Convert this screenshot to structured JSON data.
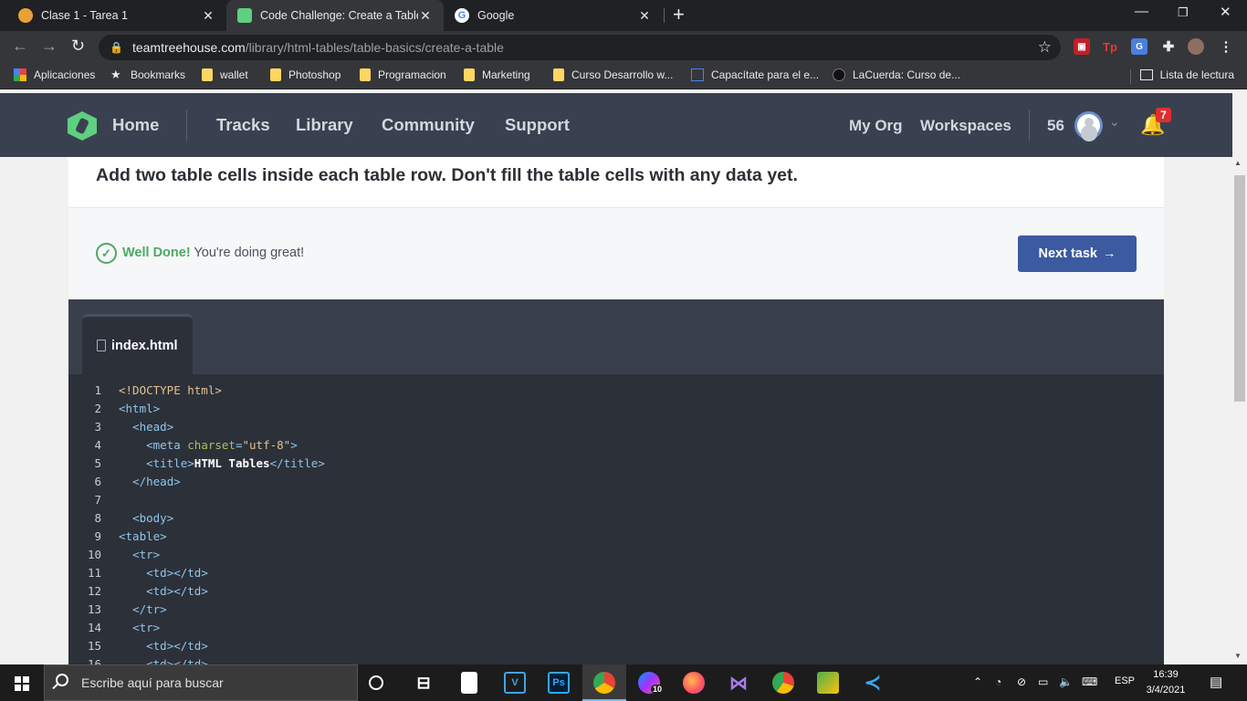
{
  "browser": {
    "tabs": [
      {
        "title": "Clase 1 - Tarea 1",
        "active": false
      },
      {
        "title": "Code Challenge: Create a Table",
        "active": true
      },
      {
        "title": "Google",
        "active": false
      }
    ],
    "url_host": "teamtreehouse.com",
    "url_path": "/library/html-tables/table-basics/create-a-table",
    "bookmarks": [
      {
        "label": "Aplicaciones",
        "icon": "apps-grid-icon"
      },
      {
        "label": "Bookmarks",
        "icon": "star-icon"
      },
      {
        "label": "wallet",
        "icon": "folder-icon"
      },
      {
        "label": "Photoshop",
        "icon": "folder-icon"
      },
      {
        "label": "Programacion",
        "icon": "folder-icon"
      },
      {
        "label": "Marketing",
        "icon": "folder-icon"
      },
      {
        "label": "Curso Desarrollo w...",
        "icon": "folder-icon"
      },
      {
        "label": "Capacítate para el e...",
        "icon": "page-icon"
      },
      {
        "label": "LaCuerda: Curso de...",
        "icon": "guitar-icon"
      }
    ],
    "reading_list": "Lista de lectura"
  },
  "header": {
    "home": "Home",
    "nav": [
      "Tracks",
      "Library",
      "Community",
      "Support"
    ],
    "my_org": "My Org",
    "workspaces": "Workspaces",
    "points": "56",
    "notifications": "7"
  },
  "task": {
    "instruction": "Add two table cells inside each table row. Don't fill the table cells with any data yet.",
    "status_strong": "Well Done!",
    "status_text": " You're doing great!",
    "next_label": "Next task"
  },
  "editor": {
    "file_name": "index.html",
    "lines": [
      "<!DOCTYPE html>",
      "<html>",
      "  <head>",
      "    <meta charset=\"utf-8\">",
      "    <title>HTML Tables</title>",
      "  </head>",
      "",
      "  <body>",
      "<table>",
      "  <tr>",
      "    <td></td>",
      "    <td></td>",
      "  </tr>",
      "  <tr>",
      "    <td></td>",
      "    <td></td>"
    ]
  },
  "taskbar": {
    "search_placeholder": "Escribe aquí para buscar",
    "messenger_badge": "10",
    "language": "ESP",
    "time": "16:39",
    "date": "3/4/2021"
  },
  "colors": {
    "treehouse_header": "#394150",
    "accent_green": "#4ea863",
    "button_blue": "#3b5aa0",
    "editor_bg": "#2c3039"
  }
}
